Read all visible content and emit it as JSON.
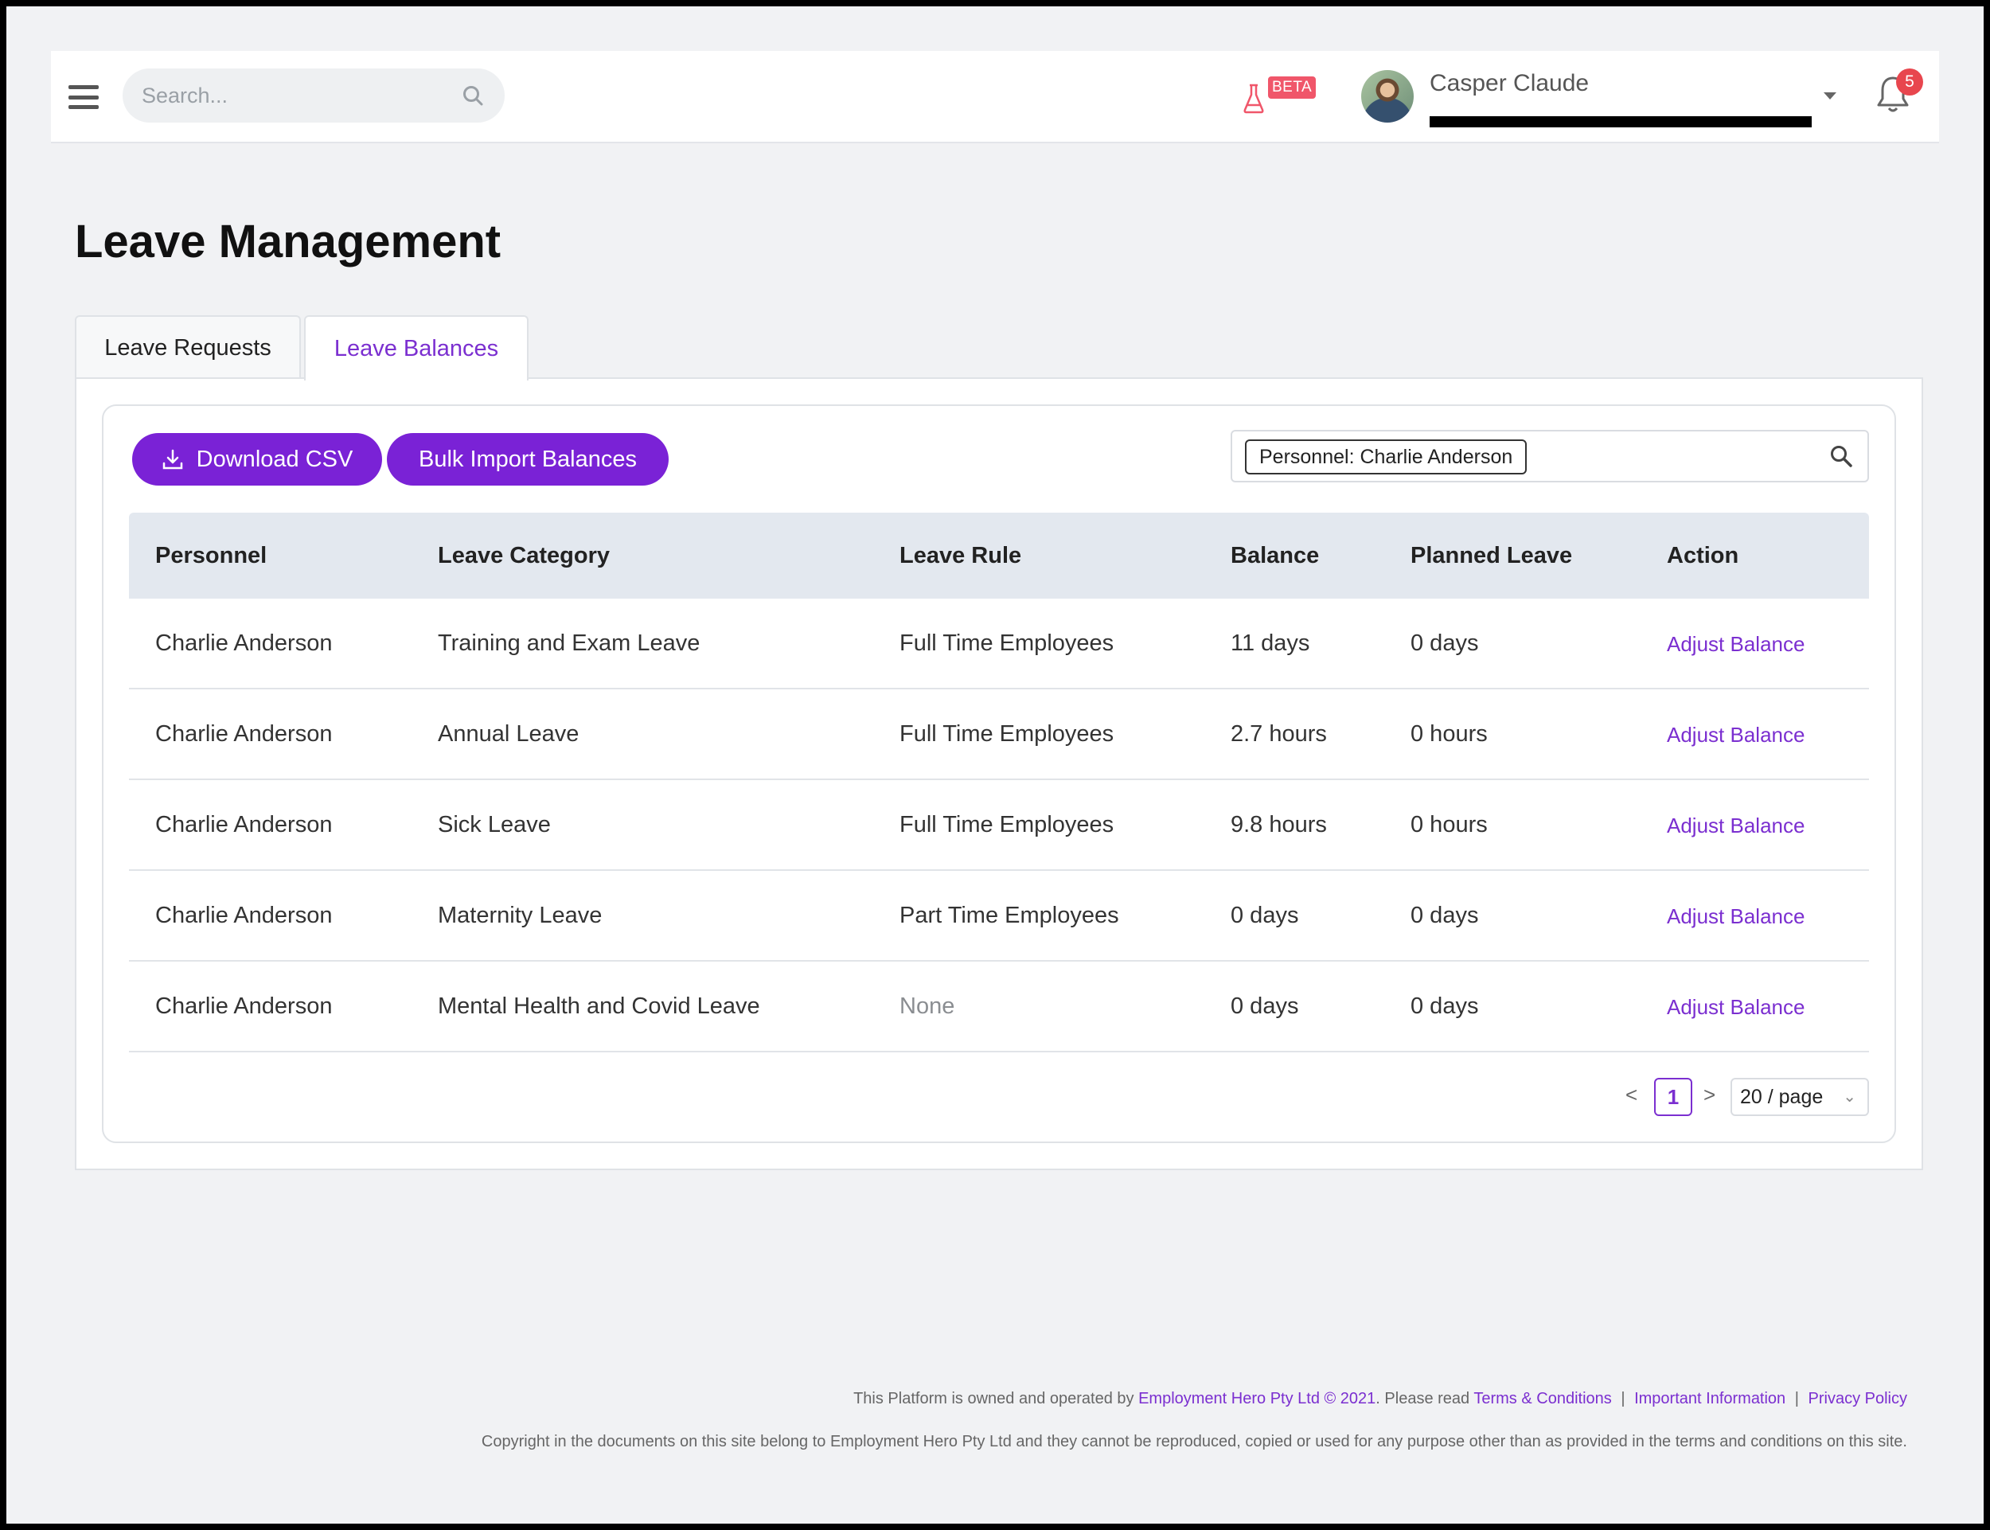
{
  "header": {
    "search_placeholder": "Search...",
    "beta_label": "BETA",
    "user_name": "Casper Claude",
    "notification_count": "5"
  },
  "page": {
    "title": "Leave Management",
    "tabs": [
      {
        "label": "Leave Requests",
        "active": false
      },
      {
        "label": "Leave Balances",
        "active": true
      }
    ]
  },
  "toolbar": {
    "download_label": "Download CSV",
    "bulk_import_label": "Bulk Import Balances",
    "filter_chip": "Personnel: Charlie Anderson"
  },
  "table": {
    "columns": [
      "Personnel",
      "Leave Category",
      "Leave Rule",
      "Balance",
      "Planned Leave",
      "Action"
    ],
    "rows": [
      {
        "personnel": "Charlie Anderson",
        "category": "Training and Exam Leave",
        "rule": "Full Time Employees",
        "balance": "11 days",
        "planned": "0 days",
        "action": "Adjust Balance"
      },
      {
        "personnel": "Charlie Anderson",
        "category": "Annual Leave",
        "rule": "Full Time Employees",
        "balance": "2.7 hours",
        "planned": "0 hours",
        "action": "Adjust Balance"
      },
      {
        "personnel": "Charlie Anderson",
        "category": "Sick Leave",
        "rule": "Full Time Employees",
        "balance": "9.8 hours",
        "planned": "0 hours",
        "action": "Adjust Balance"
      },
      {
        "personnel": "Charlie Anderson",
        "category": "Maternity Leave",
        "rule": "Part Time Employees",
        "balance": "0 days",
        "planned": "0 days",
        "action": "Adjust Balance"
      },
      {
        "personnel": "Charlie Anderson",
        "category": "Mental Health and Covid Leave",
        "rule": "None",
        "balance": "0 days",
        "planned": "0 days",
        "action": "Adjust Balance"
      }
    ]
  },
  "pagination": {
    "prev": "<",
    "next": ">",
    "current_page": "1",
    "page_size": "20 / page"
  },
  "footer": {
    "line1_prefix": "This Platform is owned and operated by",
    "company_link": "Employment Hero Pty Ltd © 2021",
    "line1_mid": ". Please read",
    "terms_link": "Terms & Conditions",
    "important_link": "Important Information",
    "privacy_link": "Privacy Policy",
    "separator": "|",
    "line2": "Copyright in the documents on this site belong to Employment Hero Pty Ltd and they cannot be reproduced, copied or used for any purpose other than as provided in the terms and conditions on this site."
  },
  "colors": {
    "accent": "#7a22d6",
    "beta_badge": "#f0566a",
    "notification_badge": "#e8464e",
    "table_header_bg": "#e3e8ef"
  },
  "icons": [
    "hamburger-menu-icon",
    "search-icon",
    "flask-icon",
    "chevron-down-icon",
    "bell-icon",
    "download-icon",
    "filter-search-icon"
  ]
}
